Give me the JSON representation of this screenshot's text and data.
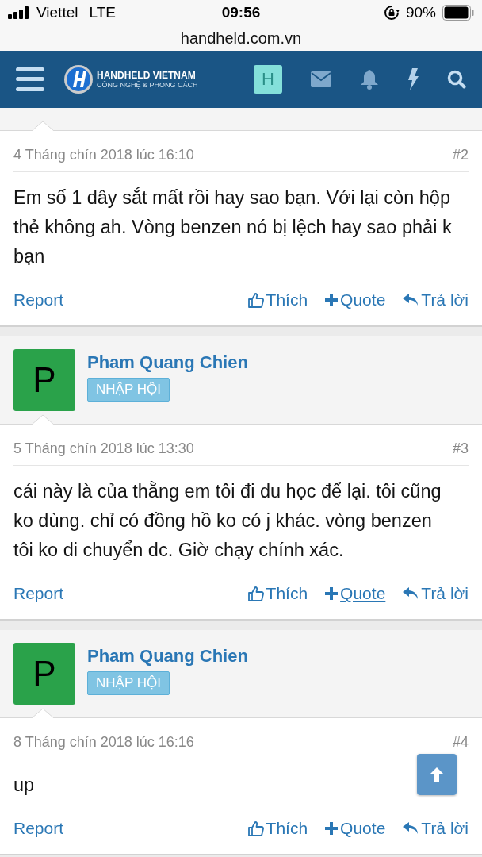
{
  "status_bar": {
    "carrier": "Viettel",
    "network": "LTE",
    "time": "09:56",
    "battery": "90%"
  },
  "address_bar": {
    "url": "handheld.com.vn"
  },
  "header": {
    "logo_title": "HANDHELD VIETNAM",
    "logo_tagline": "CÔNG NGHỆ & PHONG CÁCH",
    "user_initial": "H"
  },
  "posts": [
    {
      "date": "4 Tháng chín 2018 lúc 16:10",
      "number": "#2",
      "body": "Em số 1 dây sắt mất rồi hay sao bạn. Với lại còn hộp thẻ không ah. Vòng benzen nó bị lệch hay sao phải k bạn",
      "actions": [
        {
          "kind": "report",
          "label": "Report",
          "hovered": false
        },
        {
          "kind": "like",
          "label": "Thích",
          "hovered": false
        },
        {
          "kind": "quote",
          "label": "Quote",
          "hovered": false
        },
        {
          "kind": "reply",
          "label": "Trả lời",
          "hovered": false
        }
      ]
    },
    {
      "author": {
        "name": "Pham Quang Chien",
        "initial": "P",
        "badge": "NHẬP HỘI"
      },
      "date": "5 Tháng chín 2018 lúc 13:30",
      "number": "#3",
      "body": "cái này là của thằng em tôi đi du học để lại. tôi cũng ko dùng. chỉ có đồng hồ ko có j khác. vòng benzen tôi ko di chuyển dc. Giờ chạy chính xác.",
      "actions": [
        {
          "kind": "report",
          "label": "Report",
          "hovered": false
        },
        {
          "kind": "like",
          "label": "Thích",
          "hovered": false
        },
        {
          "kind": "quote",
          "label": "Quote",
          "hovered": true
        },
        {
          "kind": "reply",
          "label": "Trả lời",
          "hovered": false
        }
      ]
    },
    {
      "author": {
        "name": "Pham Quang Chien",
        "initial": "P",
        "badge": "NHẬP HỘI"
      },
      "date": "8 Tháng chín 2018 lúc 16:16",
      "number": "#4",
      "body": "up",
      "actions": [
        {
          "kind": "report",
          "label": "Report",
          "hovered": false
        },
        {
          "kind": "like",
          "label": "Thích",
          "hovered": false
        },
        {
          "kind": "quote",
          "label": "Quote",
          "hovered": false
        },
        {
          "kind": "reply",
          "label": "Trả lời",
          "hovered": false
        }
      ]
    }
  ]
}
